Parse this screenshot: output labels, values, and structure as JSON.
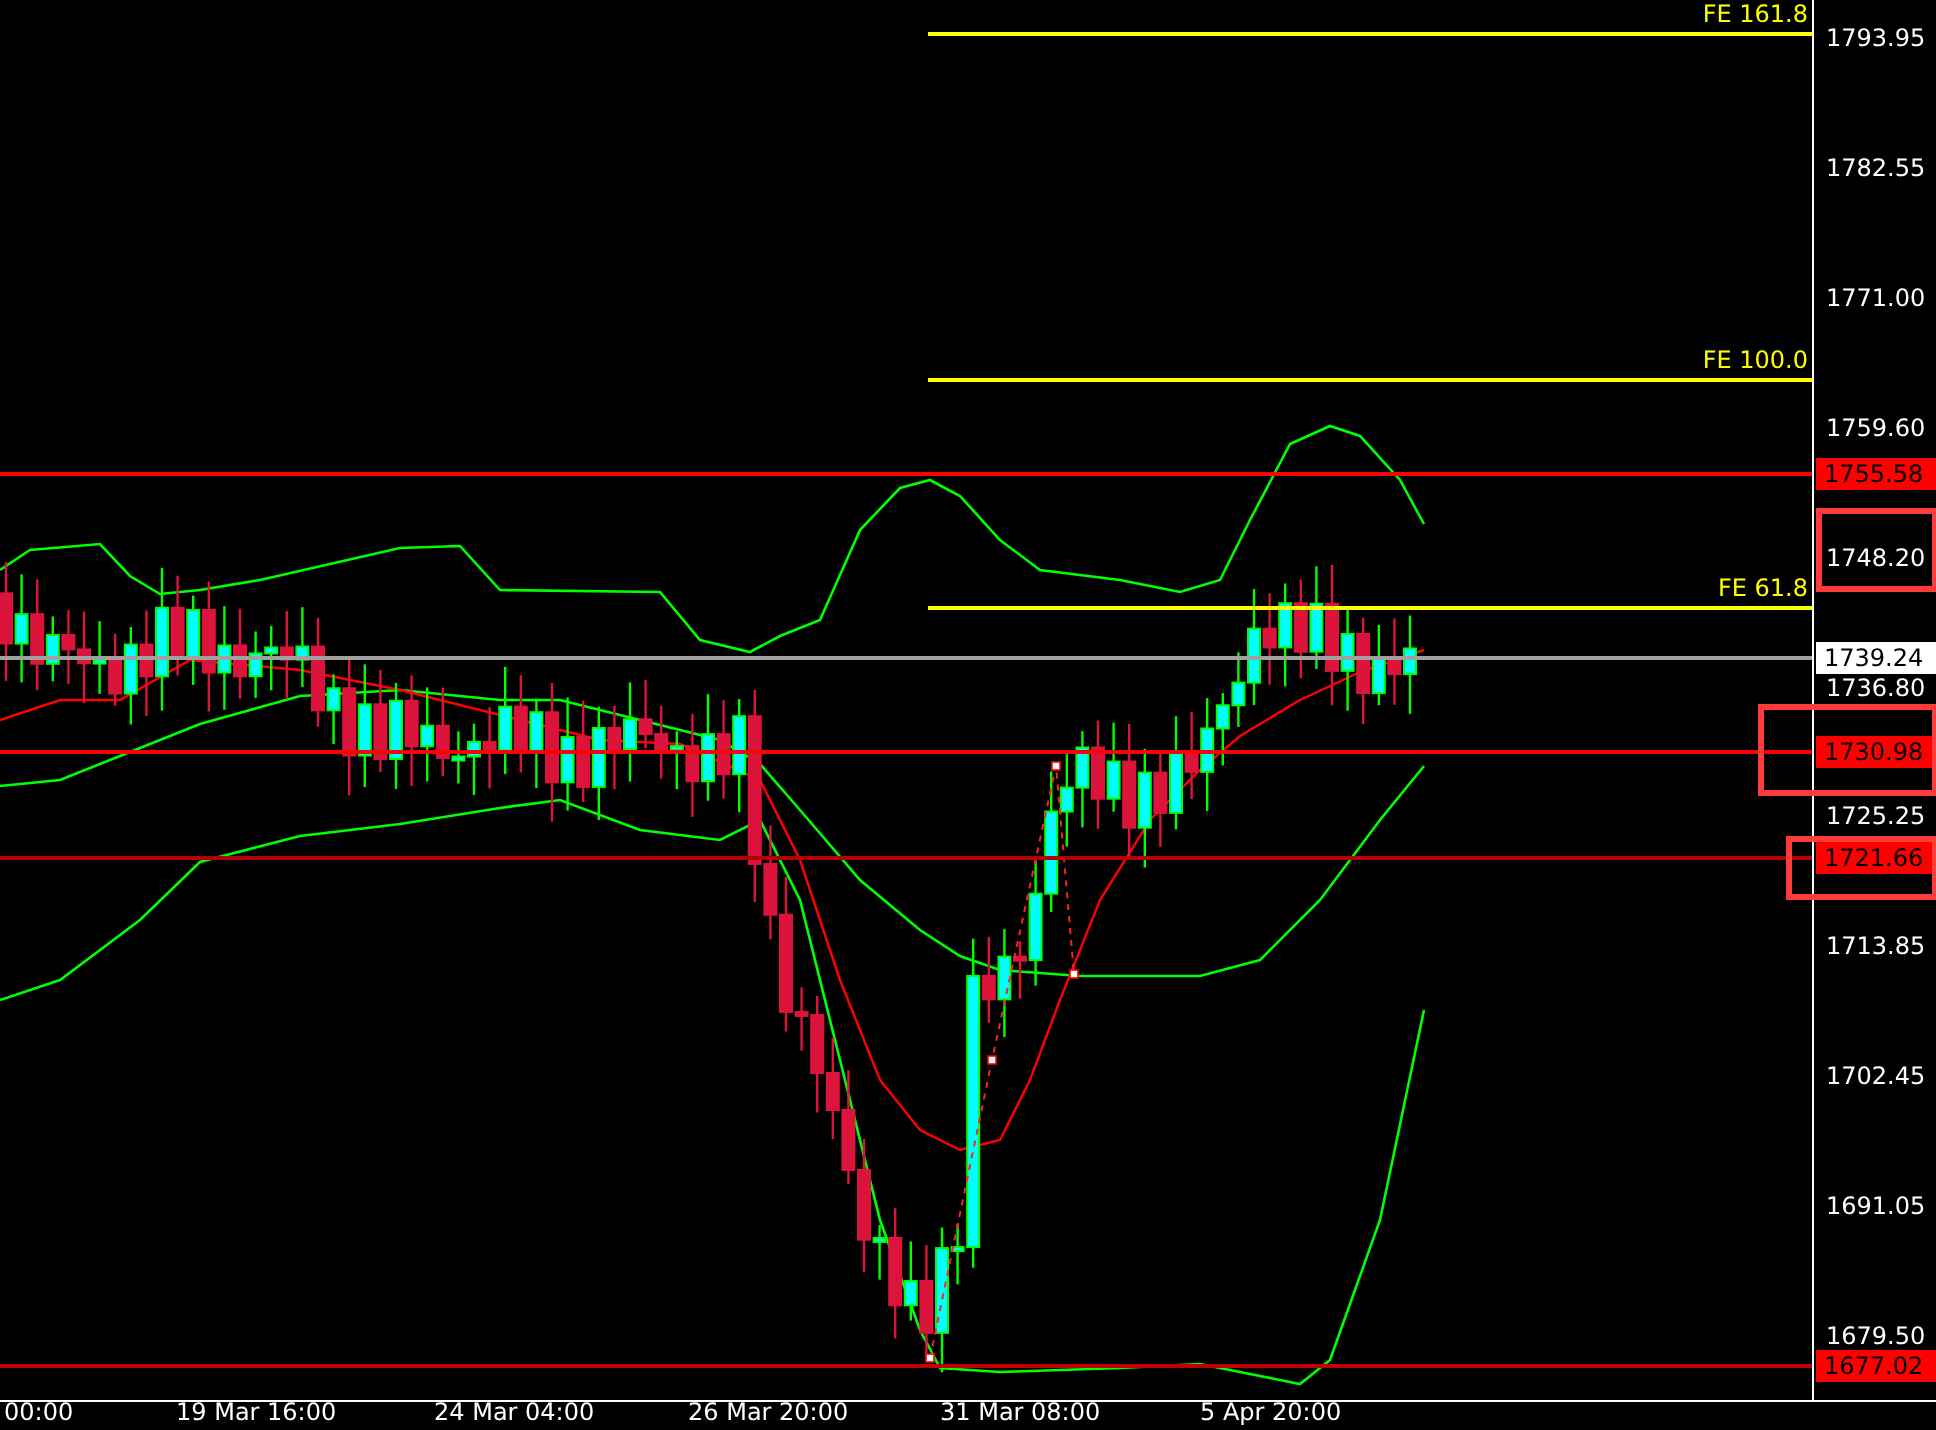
{
  "price_axis": {
    "ticks": [
      "1793.95",
      "1782.55",
      "1771.00",
      "1759.60",
      "1748.20",
      "1736.80",
      "1725.25",
      "1713.85",
      "1702.45",
      "1691.05",
      "1679.50"
    ]
  },
  "time_axis": {
    "labels": [
      "00:00",
      "19 Mar 16:00",
      "24 Mar 04:00",
      "26 Mar 20:00",
      "31 Mar 08:00",
      "5 Apr 20:00"
    ]
  },
  "levels": [
    {
      "kind": "fibo",
      "label": "FE 161.8",
      "color": "#ffff00"
    },
    {
      "kind": "fibo",
      "label": "FE 100.0",
      "color": "#ffff00"
    },
    {
      "kind": "fibo",
      "label": "FE 61.8",
      "color": "#ffff00"
    },
    {
      "kind": "level",
      "label": "1755.58",
      "color": "#ff0000"
    },
    {
      "kind": "bid",
      "label": "1739.24",
      "color": "#a0a0a0"
    },
    {
      "kind": "level",
      "label": "1730.98",
      "color": "#ff0000"
    },
    {
      "kind": "level",
      "label": "1721.66",
      "color": "#b40000"
    },
    {
      "kind": "level",
      "label": "1677.02",
      "color": "#c00000"
    }
  ]
}
